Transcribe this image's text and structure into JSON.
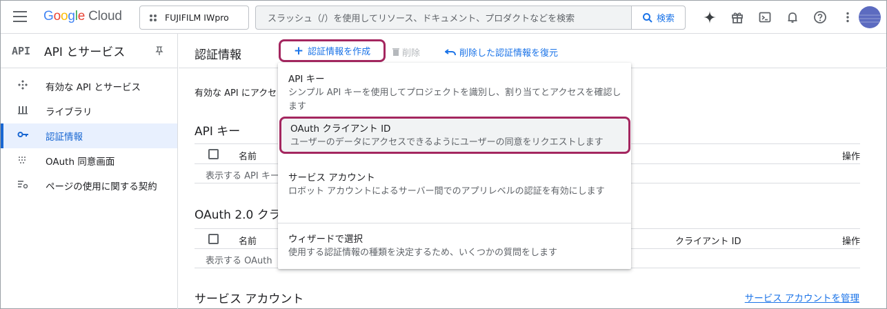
{
  "header": {
    "logo_google": [
      "G",
      "o",
      "o",
      "g",
      "l",
      "e"
    ],
    "logo_cloud": "Cloud",
    "project": "FUJIFILM IWpro",
    "search_placeholder": "スラッシュ（/）を使用してリソース、ドキュメント、プロダクトなどを検索",
    "search_button": "検索",
    "icons": [
      "spark-icon",
      "gift-icon",
      "terminal-icon",
      "bell-icon",
      "help-icon",
      "more-vert-icon"
    ]
  },
  "sidebar": {
    "api_glyph": "API",
    "title": "API とサービス",
    "items": [
      {
        "label": "有効な API とサービス",
        "icon": "api-icon"
      },
      {
        "label": "ライブラリ",
        "icon": "library-icon"
      },
      {
        "label": "認証情報",
        "icon": "key-icon",
        "active": true
      },
      {
        "label": "OAuth 同意画面",
        "icon": "consent-icon"
      },
      {
        "label": "ページの使用に関する契約",
        "icon": "settings-list-icon"
      }
    ]
  },
  "main": {
    "title": "認証情報",
    "create_label": "認証情報を作成",
    "delete_label": "削除",
    "restore_label": "削除した認証情報を復元",
    "intro": "有効な API にアクセ",
    "api_keys_title": "API キー",
    "api_table": {
      "col_name": "名前",
      "col_action": "操作",
      "empty": "表示する API キー"
    },
    "oauth_title": "OAuth 2.0 クラ",
    "oauth_table": {
      "col_name": "名前",
      "col_client": "クライアント ID",
      "col_action": "操作",
      "empty": "表示する OAuth"
    },
    "service_title": "サービス アカウント",
    "manage_link": "サービス アカウントを管理"
  },
  "dropdown": {
    "items": [
      {
        "title": "API キー",
        "desc": "シンプル API キーを使用してプロジェクトを識別し、割り当てとアクセスを確認します"
      },
      {
        "title": "OAuth クライアント ID",
        "desc": "ユーザーのデータにアクセスできるようにユーザーの同意をリクエストします"
      },
      {
        "title": "サービス アカウント",
        "desc": "ロボット アカウントによるサーバー間でのアプリレベルの認証を有効にします"
      },
      {
        "title": "ウィザードで選択",
        "desc": "使用する認証情報の種類を決定するため、いくつかの質問をします"
      }
    ]
  },
  "colors": {
    "accent": "#1a73e8",
    "highlight_border": "#a4265f"
  }
}
